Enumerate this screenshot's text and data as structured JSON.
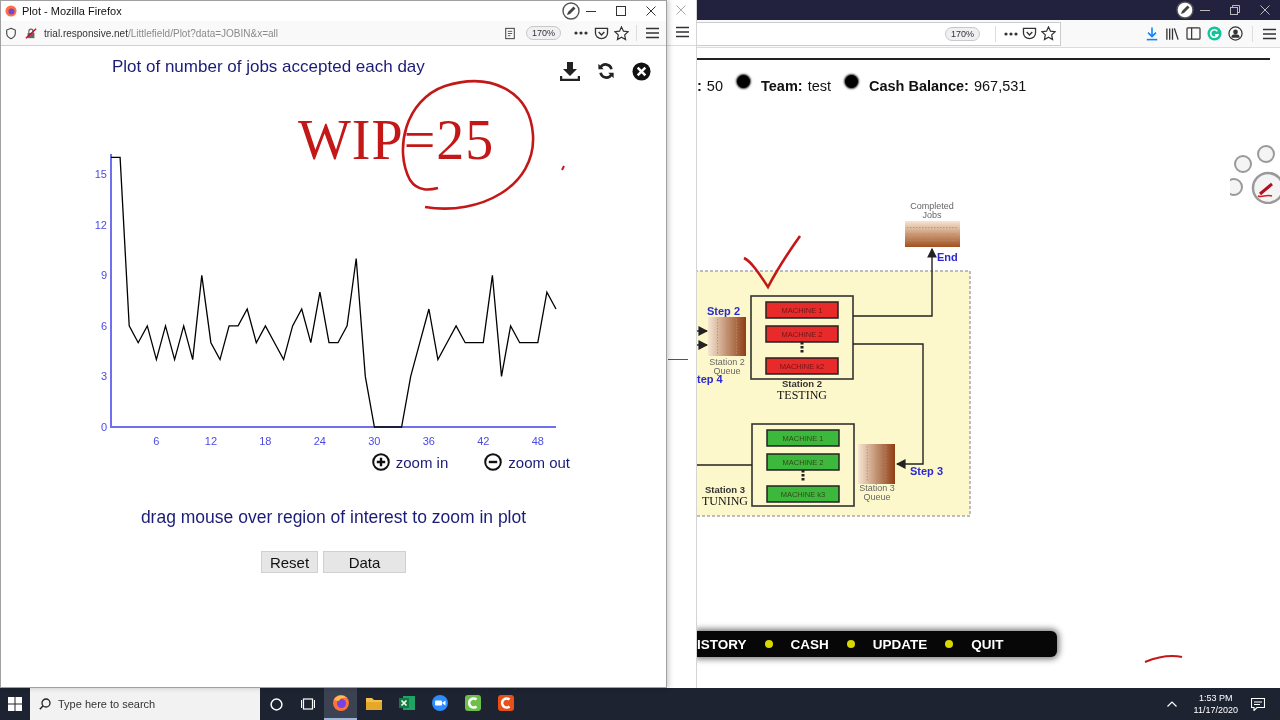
{
  "popup_window": {
    "title": "Plot - Mozilla Firefox",
    "url_host": "trial.responsive.net",
    "url_path": "/Littlefield/Plot?data=JOBIN&x=all",
    "zoom": "170%",
    "plot": {
      "chart_data": {
        "type": "line",
        "title": "Plot of number of jobs accepted each day",
        "x": [
          1,
          2,
          3,
          4,
          5,
          6,
          7,
          8,
          9,
          10,
          11,
          12,
          13,
          14,
          15,
          16,
          17,
          18,
          19,
          20,
          21,
          22,
          23,
          24,
          25,
          26,
          27,
          28,
          29,
          30,
          31,
          32,
          33,
          34,
          35,
          36,
          37,
          38,
          39,
          40,
          41,
          42,
          43,
          44,
          45,
          46,
          47,
          48,
          49,
          50
        ],
        "series": [
          {
            "color": "#000000",
            "values": [
              16,
              16,
              6,
              5,
              6,
              4,
              6,
              4,
              6,
              4,
              9,
              5,
              4,
              6,
              6,
              7,
              5,
              6,
              5,
              4,
              6,
              7,
              5,
              8,
              5,
              5,
              6,
              10,
              3,
              0,
              0,
              0,
              0,
              3,
              5,
              7,
              4,
              5,
              6,
              5,
              5,
              5,
              9,
              3,
              6,
              5,
              5,
              5,
              8,
              7
            ]
          }
        ],
        "xlim": [
          1,
          50
        ],
        "ylim": [
          0,
          16.2
        ],
        "xticks": [
          6,
          12,
          18,
          24,
          30,
          36,
          42,
          48
        ],
        "yticks": [
          0,
          3,
          6,
          9,
          12,
          15
        ]
      },
      "zoom_in": "zoom in",
      "zoom_out": "zoom out",
      "hint": "drag mouse over region of interest to zoom in plot",
      "buttons": [
        "Reset",
        "Data"
      ]
    }
  },
  "main_window": {
    "zoom": "170%",
    "status": [
      {
        "label": ":",
        "value": "50"
      },
      {
        "label": "Team:",
        "value": "test"
      },
      {
        "label": "Cash Balance:",
        "value": "967,531"
      }
    ],
    "diagram": {
      "completed_label": "Completed Jobs",
      "end_label": "End",
      "back_step": "tep 4",
      "stations": [
        {
          "step": "Step 2",
          "queue": "Station 2 Queue",
          "name": "Station 2",
          "function": "TESTING",
          "color": "#e82a2a",
          "machines": [
            "MACHINE 1",
            "MACHINE 2",
            "MACHINE k2"
          ]
        },
        {
          "step": "Step 3",
          "queue": "Station 3 Queue",
          "name": "Station 3",
          "function": "TUNING",
          "color": "#3cb83c",
          "machines": [
            "MACHINE 1",
            "MACHINE 2",
            "MACHINE k3"
          ]
        }
      ]
    },
    "menu": [
      "ISTORY",
      "CASH",
      "UPDATE",
      "QUIT"
    ]
  },
  "annotation": {
    "handwriting": "WIP=25"
  },
  "taskbar": {
    "search_placeholder": "Type here to search",
    "apps": [
      {
        "kind": "browser",
        "selected": true
      },
      {
        "kind": "folder",
        "selected": false
      },
      {
        "kind": "spreadsheet",
        "selected": false
      },
      {
        "kind": "video",
        "selected": false
      },
      {
        "kind": "editor",
        "selected": false
      },
      {
        "kind": "recorder",
        "selected": false
      }
    ],
    "time": "1:53 PM",
    "date": "11/17/2020"
  }
}
